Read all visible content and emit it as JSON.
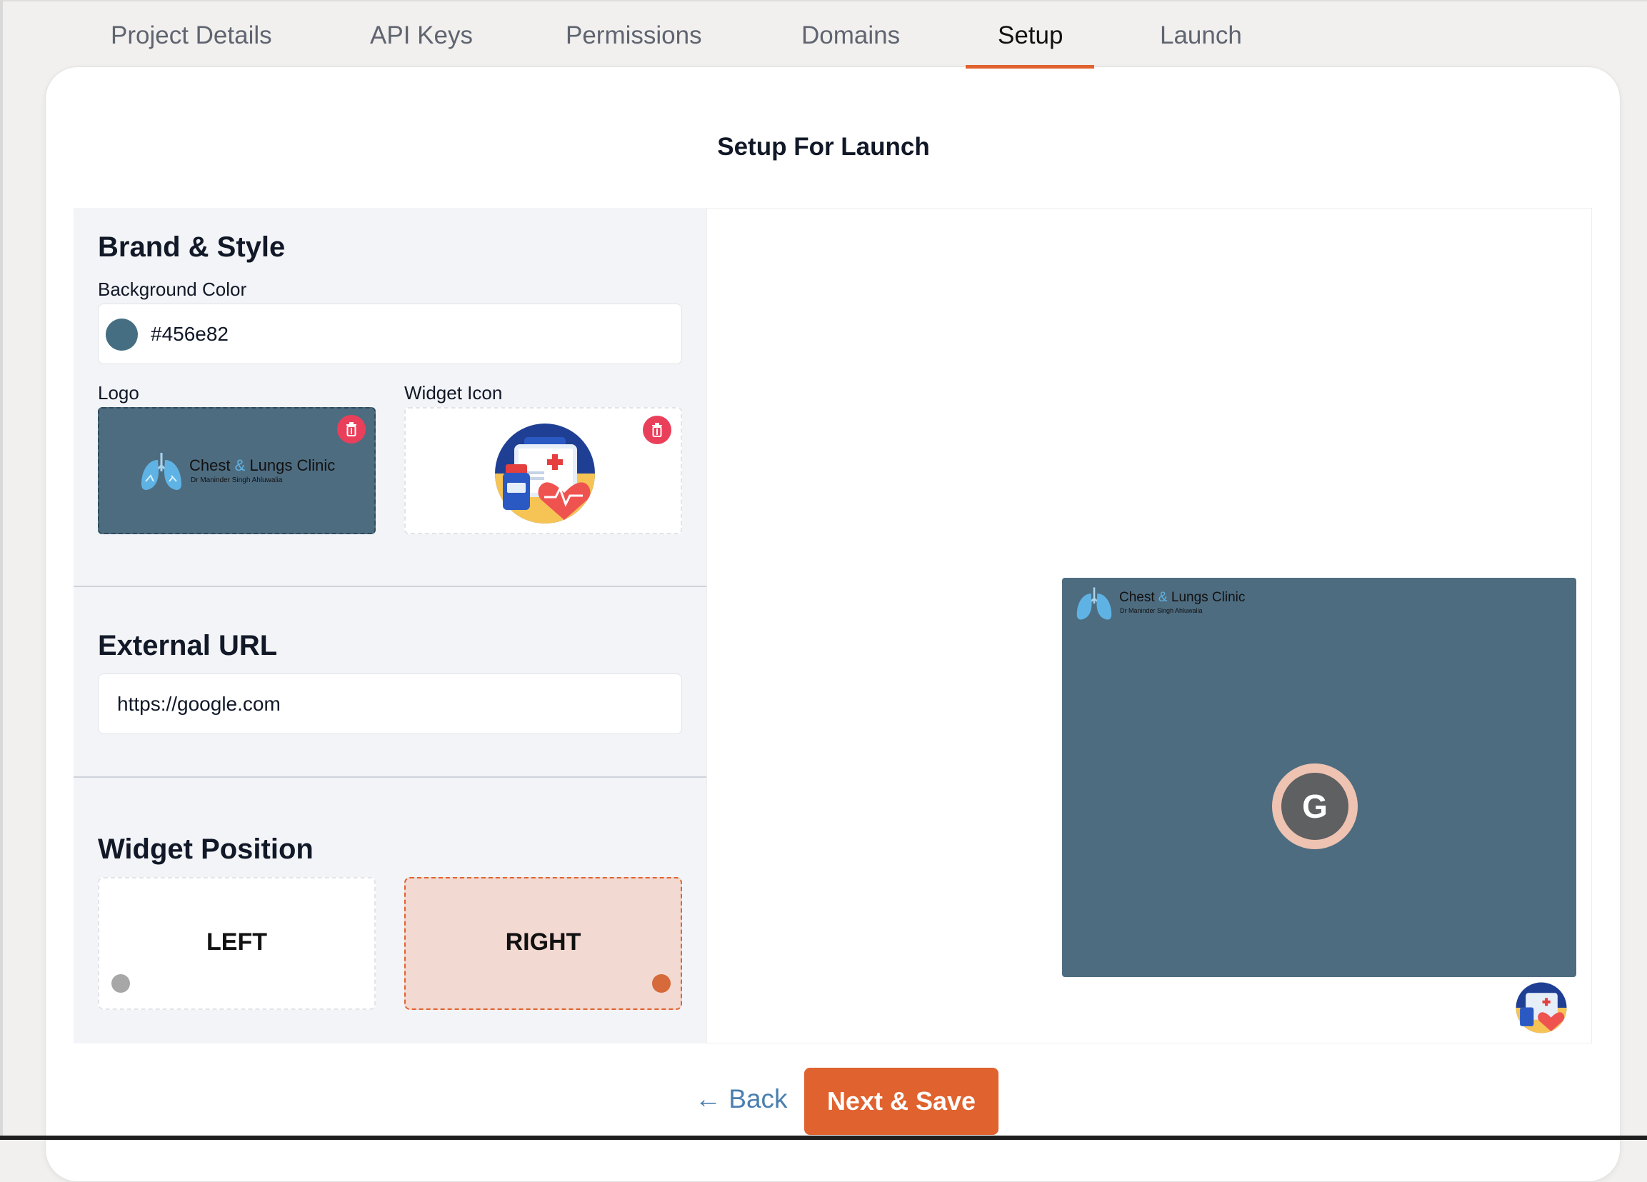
{
  "tabs": [
    {
      "label": "Project Details"
    },
    {
      "label": "API Keys"
    },
    {
      "label": "Permissions"
    },
    {
      "label": "Domains"
    },
    {
      "label": "Setup",
      "active": true
    },
    {
      "label": "Launch"
    }
  ],
  "page_title": "Setup For Launch",
  "brand": {
    "title": "Brand & Style",
    "background_color_label": "Background Color",
    "background_color_value": "#456e82",
    "swatch_color": "#456e82",
    "logo_label": "Logo",
    "widget_icon_label": "Widget Icon"
  },
  "logo": {
    "brand_word1": "Chest",
    "brand_amp": "&",
    "brand_word2": "Lungs Clinic",
    "subtitle": "Dr Maninder Singh Ahluwalia"
  },
  "external_url": {
    "title": "External URL",
    "value": "https://google.com"
  },
  "widget_position": {
    "title": "Widget Position",
    "left_label": "LEFT",
    "right_label": "RIGHT",
    "selected": "right"
  },
  "preview": {
    "avatar_letter": "G"
  },
  "footer": {
    "back_label": "← Back",
    "next_label": "Next & Save"
  },
  "colors": {
    "accent": "#e0622f",
    "widget_bg": "#4e6c80",
    "delete": "#ea3f5a",
    "link": "#4a7fb0"
  },
  "icons": [
    "trash-icon",
    "lungs-icon",
    "medical-kit-icon",
    "back-arrow-icon"
  ]
}
